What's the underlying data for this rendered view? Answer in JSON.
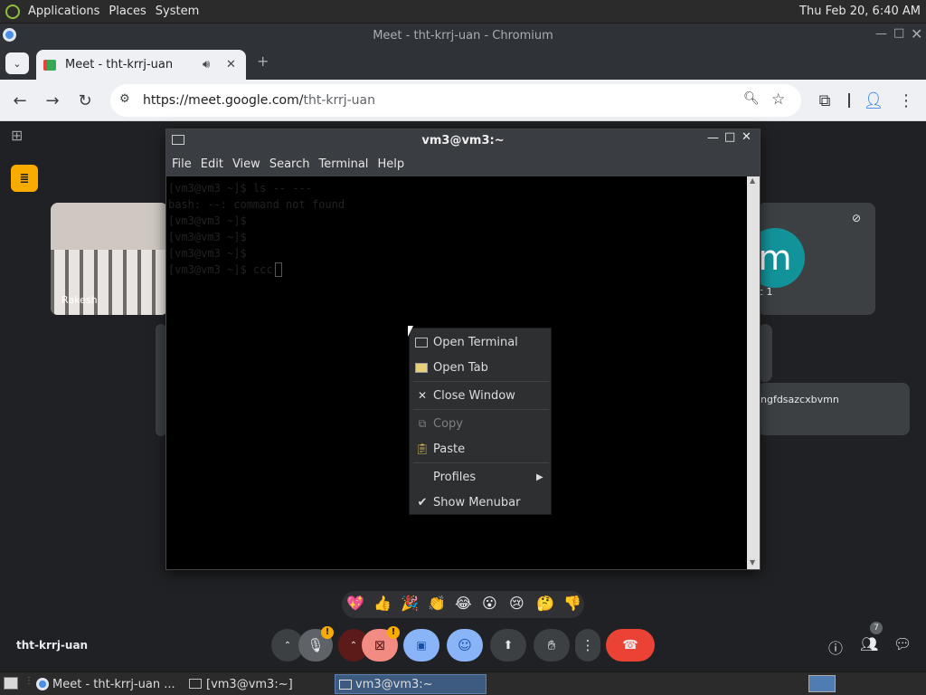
{
  "top_panel": {
    "applications": "Applications",
    "places": "Places",
    "system": "System",
    "clock": "Thu Feb 20,  6:40 AM"
  },
  "chrome": {
    "window_title": "Meet - tht-krrj-uan - Chromium",
    "tab_title": "Meet - tht-krrj-uan",
    "url_host": "https://meet.google.com/",
    "url_path": "tht-krrj-uan"
  },
  "meet": {
    "tile_left_name": "Rakesh",
    "tile_right_label": "c 1",
    "avatar_letter": "m",
    "participant_text": "ngfdsazcxbvmn",
    "meeting_code": "tht-krrj-uan",
    "people_count": "7",
    "warning_badge": "!",
    "emojis": [
      "💖",
      "👍",
      "🎉",
      "👏",
      "😂",
      "😮",
      "😢",
      "🤔",
      "👎"
    ]
  },
  "terminal": {
    "title": "vm3@vm3:~",
    "menu": [
      "File",
      "Edit",
      "View",
      "Search",
      "Terminal",
      "Help"
    ],
    "lines": [
      "[vm3@vm3 ~]$ ls -- ---",
      "bash: --: command not found",
      "[vm3@vm3 ~]$",
      "[vm3@vm3 ~]$",
      "[vm3@vm3 ~]$",
      "[vm3@vm3 ~]$ ccc"
    ]
  },
  "context_menu": {
    "open_terminal": "Open Terminal",
    "open_tab": "Open Tab",
    "close_window": "Close Window",
    "copy": "Copy",
    "paste": "Paste",
    "profiles": "Profiles",
    "show_menubar": "Show Menubar"
  },
  "taskbar": {
    "item1": "Meet - tht-krrj-uan ...",
    "item2": "[vm3@vm3:~]",
    "item3": "vm3@vm3:~"
  }
}
